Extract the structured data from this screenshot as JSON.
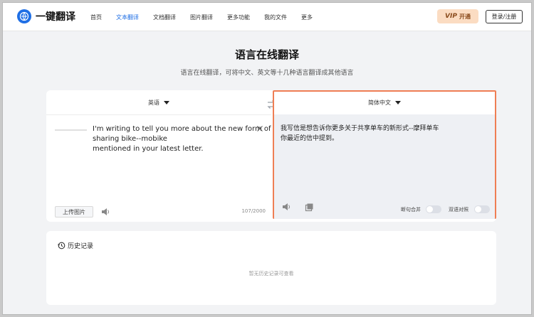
{
  "header": {
    "logo_text": "一键翻译",
    "nav": [
      {
        "label": "首页",
        "active": false
      },
      {
        "label": "文本翻译",
        "active": true
      },
      {
        "label": "文档翻译",
        "active": false
      },
      {
        "label": "图片翻译",
        "active": false
      },
      {
        "label": "更多功能",
        "active": false
      },
      {
        "label": "我的文件",
        "active": false
      },
      {
        "label": "更多",
        "active": false
      }
    ],
    "vip_label": "VIP",
    "vip_action": "开通",
    "login_label": "登录/注册"
  },
  "page": {
    "title": "语言在线翻译",
    "subtitle": "语言在线翻译，可将中文、英文等十几种语言翻译成其他语言"
  },
  "translator": {
    "source_lang": "英语",
    "target_lang": "简体中文",
    "source_lines": [
      "I'm writing to tell you more about the new form of",
      "sharing bike--mobike",
      "mentioned in your latest letter."
    ],
    "target_lines": [
      "我写信是想告诉你更多关于共享单车的新形式--摩拜单车",
      "你最近的信中提到。"
    ],
    "upload_label": "上传图片",
    "char_count": "107/2000",
    "toggle_sentence_merge": "断句合并",
    "toggle_bilingual": "双语对照"
  },
  "history": {
    "title": "历史记录",
    "empty_text": "暂无历史记录可查看"
  },
  "colors": {
    "accent": "#1f6fe5",
    "highlight_border": "#ef7e54",
    "vip_bg": "#fbdcc2"
  }
}
